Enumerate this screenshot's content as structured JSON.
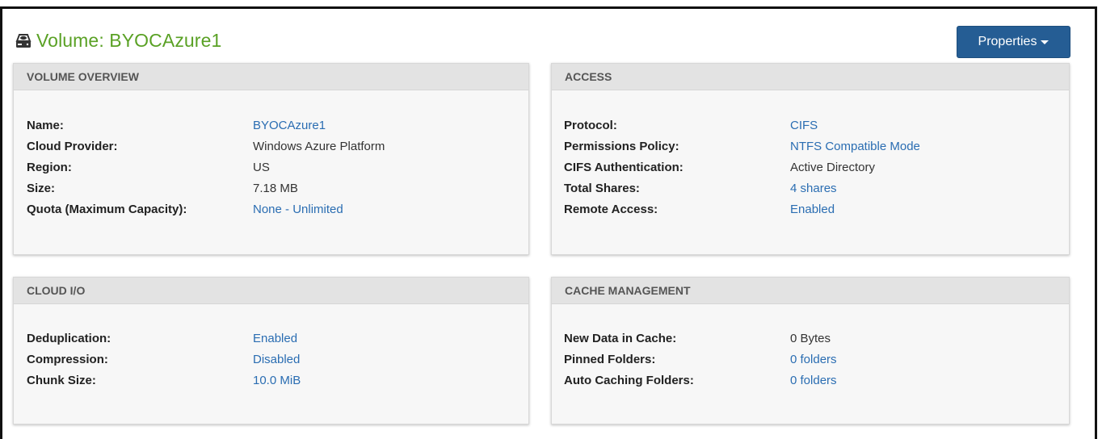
{
  "header": {
    "title": "Volume: BYOCAzure1",
    "title_icon": "hard-drive-icon",
    "title_color": "#5aa125",
    "properties_label": "Properties",
    "properties_color": "#255d94"
  },
  "panels": {
    "volume_overview": {
      "heading": "VOLUME OVERVIEW",
      "rows": [
        {
          "key": "Name:",
          "value": "BYOCAzure1",
          "link": true
        },
        {
          "key": "Cloud Provider:",
          "value": "Windows Azure Platform",
          "link": false
        },
        {
          "key": "Region:",
          "value": "US",
          "link": false
        },
        {
          "key": "Size:",
          "value": "7.18 MB",
          "link": false
        },
        {
          "key": "Quota (Maximum Capacity):",
          "value": "None - Unlimited",
          "link": true
        }
      ]
    },
    "access": {
      "heading": "ACCESS",
      "rows": [
        {
          "key": "Protocol:",
          "value": "CIFS",
          "link": true
        },
        {
          "key": "Permissions Policy:",
          "value": "NTFS Compatible Mode",
          "link": true
        },
        {
          "key": "CIFS Authentication:",
          "value": "Active Directory",
          "link": false
        },
        {
          "key": "Total Shares:",
          "value": "4 shares",
          "link": true
        },
        {
          "key": "Remote Access:",
          "value": "Enabled",
          "link": true
        }
      ]
    },
    "cloud_io": {
      "heading": "CLOUD I/O",
      "rows": [
        {
          "key": "Deduplication:",
          "value": "Enabled",
          "link": true
        },
        {
          "key": "Compression:",
          "value": "Disabled",
          "link": true
        },
        {
          "key": "Chunk Size:",
          "value": "10.0 MiB",
          "link": true
        }
      ]
    },
    "cache_management": {
      "heading": "CACHE MANAGEMENT",
      "rows": [
        {
          "key": "New Data in Cache:",
          "value": "0 Bytes",
          "link": false
        },
        {
          "key": "Pinned Folders:",
          "value": "0 folders",
          "link": true
        },
        {
          "key": "Auto Caching Folders:",
          "value": "0 folders",
          "link": true
        }
      ]
    }
  }
}
